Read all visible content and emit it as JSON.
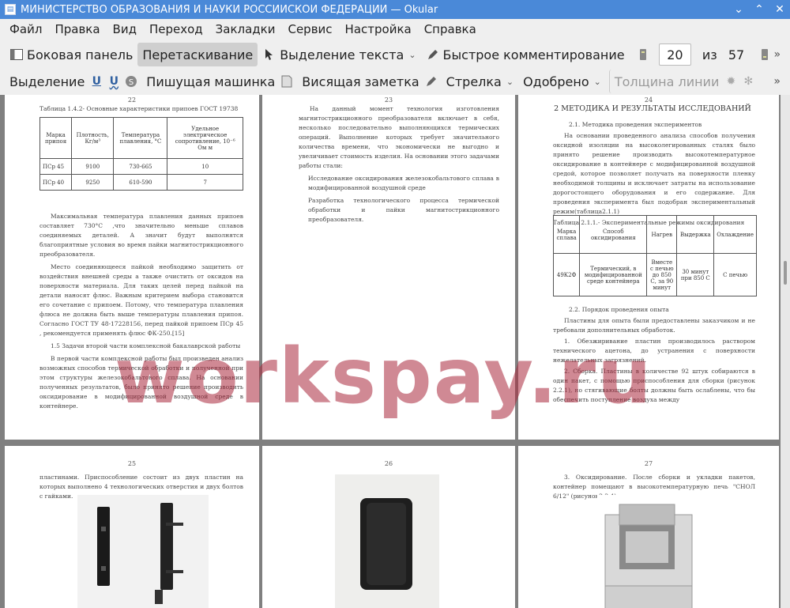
{
  "window": {
    "title": "МИНИСТЕРСТВО ОБРАЗОВАНИЯ И НАУКИ РОССИЙСКОЙ ФЕДЕРАЦИИ  — Okular"
  },
  "menubar": [
    "Файл",
    "Правка",
    "Вид",
    "Переход",
    "Закладки",
    "Сервис",
    "Настройка",
    "Справка"
  ],
  "toolbar1": {
    "sidebar": "Боковая панель",
    "browse": "Перетаскивание",
    "text_select": "Выделение текста",
    "quick_comment": "Быстрое комментирование",
    "current_page": "20",
    "of_label": "из",
    "total_pages": "57"
  },
  "toolbar2": {
    "selection": "Выделение",
    "typewriter": "Пишущая машинка",
    "popup_note": "Висящая заметка",
    "arrow": "Стрелка",
    "stamp": "Одобрено",
    "line_width": "Толщина линии"
  },
  "watermark": "workspay.ru",
  "pages": {
    "p22": {
      "number": "22",
      "table_caption": "Таблица 1.4.2- Основные характеристики припоев ГОСТ 19738",
      "headers": [
        "Марка припоя",
        "Плотность, Кг/м³",
        "Температура плавления, °С",
        "Удельное электрическое сопротивление, 10⁻⁶ Ом м"
      ],
      "rows": [
        [
          "ПСр 45",
          "9100",
          "730-665",
          "10"
        ],
        [
          "ПСр 40",
          "9250",
          "610-590",
          "7"
        ]
      ],
      "para1": "Максимальная температура плавления данных припоев составляет 730°С ,что значительно меньше сплавов соединяемых деталей. А значит будут выполнятся благоприятные условия во время пайки магнитострикционного преобразователя.",
      "para2": "Место соединяющееся пайкой необходимо защитить от воздействия внешней среды а также очистить от оксидов на поверхности материала. Для таких целей перед пайкой на детали наносят флюс. Важным критерием выбора становится его сочетание с припоем. Потому, что температура плавления флюса не должна быть выше температуры плавления припоя. Согласно ГОСТ ТУ 48-17228156, перед пайкой припоем ПСр 45 , рекомендуется применять флюс ФК-250.[15]",
      "subheading": "1.5 Задачи второй части комплексной бакалаврской работы",
      "para3": "В первой части комплексной работы был произведен анализ возможных способов термической обработки и полученной при этом структуры железокобальтового сплава. На основании полученных результатов, было принято решение производить оксидирование в модифицированной воздушной среде в контейнере."
    },
    "p23": {
      "number": "23",
      "para1": "На данный момент технология изготовления магнитострикционного преобразователя включает в себя, несколько последовательно выполняющихся термических операций. Выполнение которых требует значительного количества времени, что экономически не выгодно и увеличивает стоимость изделия. На основании этого задачами работы стали:",
      "item1": "Исследование оксидирования железокобальтового сплава в модифицированной воздушной среде",
      "item2": "Разработка технологического процесса термической обработки и пайки магнитострикционного преобразователя."
    },
    "p24": {
      "number": "24",
      "heading": "2 МЕТОДИКА И РЕЗУЛЬТАТЫ ИССЛЕДОВАНИЙ",
      "sub1": "2.1. Методика проведения экспериментов",
      "para1": "На основании проведенного анализа способов получения оксидной изоляции на высоколегированных сталях было принято решение производить высокотемпературное оксидирование в контейнере с модифицированной воздушной средой, которое позволяет получать на поверхности пленку необходимой толщины и исключает затраты на использование дорогостоящего оборудования и его содержание. Для проведения эксперимента был подобран экспериментальный режим(таблица2.1.1)",
      "table_caption": "Таблица 2.1.1.- Экспериментальные режимы оксидирования",
      "headers": [
        "Марка сплава",
        "Способ оксидирования",
        "Нагрев",
        "Выдержка",
        "Охлаждение"
      ],
      "row": [
        "49К2Ф",
        "Термический, в модифицированной среде контейнера",
        "Вместе с печью до 850 С, за 90 минут",
        "30 минут при 850 С",
        "С печью"
      ],
      "sub2": "2.2. Порядок проведения опыта",
      "para2": "Пластины для опыта были предоставлены заказчиком и не требовали дополнительных обработок.",
      "item1": "1. Обезжиривание пластин производилось раствором технического ацетона, до устранения с поверхности нежелательных загрязнений.",
      "item2": "2. Сборка. Пластины в количестве 92 штук собираются в один пакет, с помощью приспособления для сборки (рисунок 2.2.1), но стягивающие болты должны быть ослаблены, что бы обеспечить поступление воздуха между"
    },
    "p25": {
      "number": "25",
      "para1": "пластинами. Приспособление состоит из двух пластин на которых выполнено 4 технологических отверстия и двух болтов с гайками."
    },
    "p26": {
      "number": "26"
    },
    "p27": {
      "number": "27",
      "para1": "3. Оксидирование. После сборки и укладки пакетов, контейнер помещают в высокотемпературную печь \"СНОЛ 6/12\" (рисунок2.2.4)."
    }
  }
}
